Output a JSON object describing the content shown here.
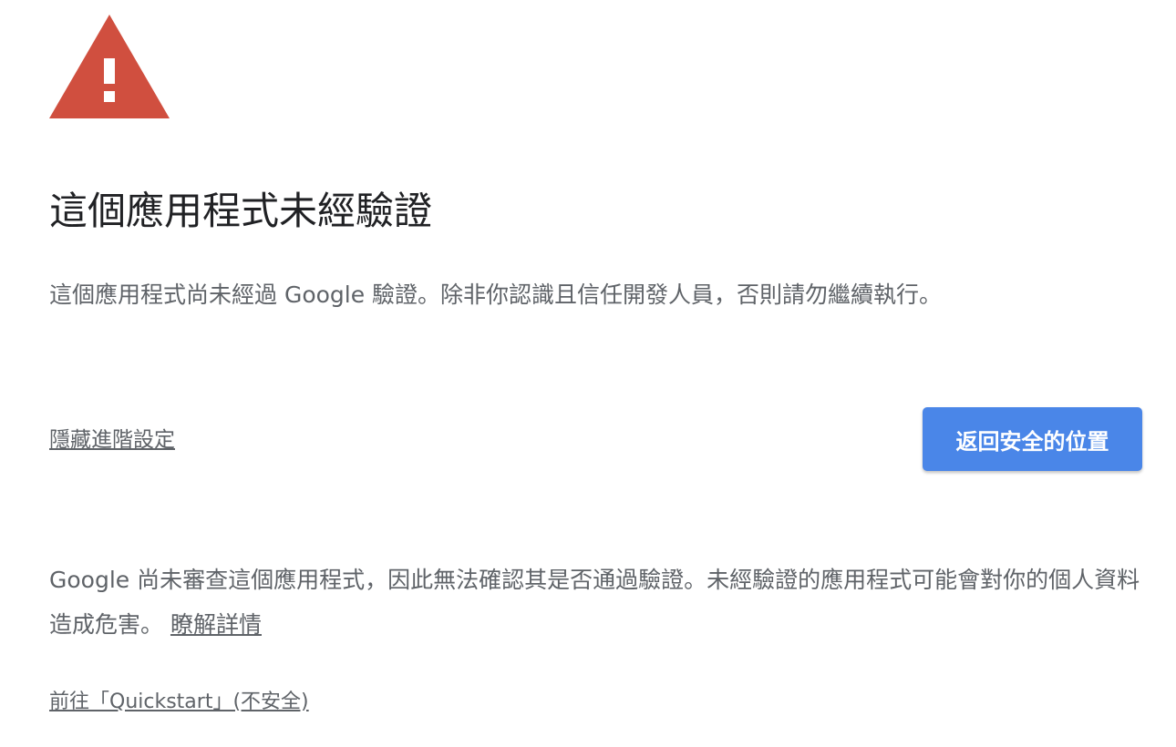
{
  "colors": {
    "warning_red": "#d04f3f",
    "button_blue": "#4a86e8",
    "heading_text": "#202124",
    "body_text": "#5f6368"
  },
  "icon": {
    "warning": "warning-triangle-icon"
  },
  "heading": "這個應用程式未經驗證",
  "intro": "這個應用程式尚未經過 Google 驗證。除非你認識且信任開發人員，否則請勿繼續執行。",
  "advanced_link": "隱藏進階設定",
  "back_button": "返回安全的位置",
  "details": {
    "text": "Google 尚未審查這個應用程式，因此無法確認其是否通過驗證。未經驗證的應用程式可能會對你的個人資料造成危害。",
    "learn_more": "瞭解詳情"
  },
  "proceed_link": "前往「Quickstart」(不安全)"
}
